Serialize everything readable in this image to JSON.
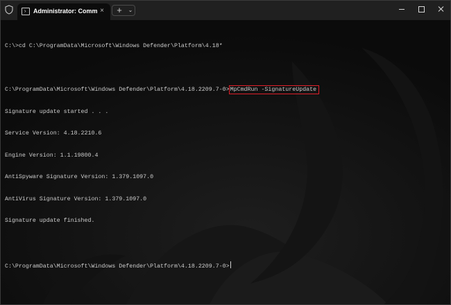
{
  "window": {
    "tab_title": "Administrator: Command Pro",
    "tab_close": "×",
    "new_tab": "+",
    "dropdown": "⌄"
  },
  "terminal": {
    "line1": "C:\\>cd C:\\ProgramData\\Microsoft\\Windows Defender\\Platform\\4.18*",
    "line2_prompt": "C:\\ProgramData\\Microsoft\\Windows Defender\\Platform\\4.18.2209.7-0>",
    "line2_command": "MpCmdRun -SignatureUpdate",
    "line3": "Signature update started . . .",
    "line4": "Service Version: 4.18.2210.6",
    "line5": "Engine Version: 1.1.19800.4",
    "line6": "AntiSpyware Signature Version: 1.379.1097.0",
    "line7": "AntiVirus Signature Version: 1.379.1097.0",
    "line8": "Signature update finished.",
    "line9_prompt": "C:\\ProgramData\\Microsoft\\Windows Defender\\Platform\\4.18.2209.7-0>"
  },
  "colors": {
    "highlight_border": "#e0202a",
    "terminal_bg": "#0c0c0c",
    "text": "#cccccc"
  },
  "icons": [
    "shield-icon",
    "terminal-icon",
    "close-icon",
    "plus-icon",
    "chevron-down-icon",
    "minimize-icon",
    "maximize-icon",
    "window-close-icon"
  ]
}
